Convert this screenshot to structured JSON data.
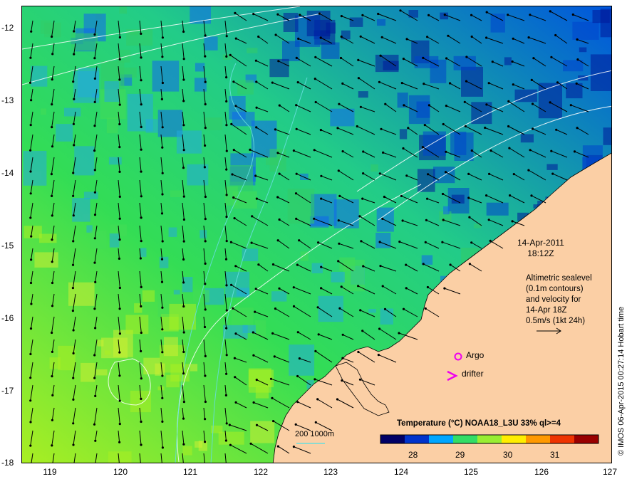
{
  "map": {
    "lat_ticks": [
      "-12",
      "-13",
      "-14",
      "-15",
      "-16",
      "-17",
      "-18"
    ],
    "lon_ticks": [
      "119",
      "120",
      "121",
      "122",
      "123",
      "124",
      "125",
      "126",
      "127"
    ],
    "lon_range": [
      118.6,
      127
    ],
    "lat_range": [
      -18,
      -11.95
    ],
    "variable": "sea surface temperature",
    "overlays": [
      "sealevel contours",
      "velocity arrows",
      "200m / 1000m isobaths"
    ]
  },
  "annotations": {
    "date": "14-Apr-2011",
    "time": "18:12Z",
    "info_lines": [
      "Altimetric sealevel",
      "(0.1m contours)",
      "and velocity for",
      "14-Apr 18Z",
      "0.5m/s (1kt 24h)"
    ],
    "scale_label": "200  1000m",
    "argo_label": "Argo",
    "drifter_label": "drifter",
    "credit": "© IMOS 06-Apr-2015 00:27:14 Hobart time"
  },
  "legend": {
    "title": "Temperature (°C) NOAA18_L3U 33% ql>=4",
    "ticks": [
      "28",
      "29",
      "30",
      "31"
    ],
    "tick_values": [
      28,
      29,
      30,
      31
    ],
    "range": [
      27.3,
      31.9
    ],
    "colors": [
      "#000066",
      "#0033cc",
      "#00a6ff",
      "#33dd66",
      "#99ee33",
      "#ffee00",
      "#ff9900",
      "#ee3300",
      "#990000"
    ]
  },
  "colors": {
    "land": "#fbcfa5",
    "arrow": "#000000",
    "contour": "#ffffff",
    "isobath": "#66dddd",
    "marker": "#ee00ee"
  }
}
